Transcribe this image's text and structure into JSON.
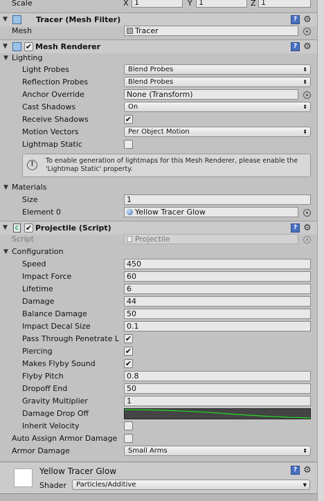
{
  "top": {
    "scale_label": "Scale",
    "x_label": "X",
    "x_value": "1",
    "y_label": "Y",
    "y_value": "1",
    "z_label": "Z",
    "z_value": "1"
  },
  "mesh_filter": {
    "title": "Tracer (Mesh Filter)",
    "mesh_label": "Mesh",
    "mesh_value": "Tracer"
  },
  "mesh_renderer": {
    "title": "Mesh Renderer",
    "lighting_label": "Lighting",
    "light_probes_label": "Light Probes",
    "light_probes_value": "Blend Probes",
    "reflection_probes_label": "Reflection Probes",
    "reflection_probes_value": "Blend Probes",
    "anchor_override_label": "Anchor Override",
    "anchor_override_value": "None (Transform)",
    "cast_shadows_label": "Cast Shadows",
    "cast_shadows_value": "On",
    "receive_shadows_label": "Receive Shadows",
    "motion_vectors_label": "Motion Vectors",
    "motion_vectors_value": "Per Object Motion",
    "lightmap_static_label": "Lightmap Static",
    "help_line1": "To enable generation of lightmaps for this Mesh Renderer, please enable the",
    "help_line2": "'Lightmap Static' property.",
    "materials_label": "Materials",
    "size_label": "Size",
    "size_value": "1",
    "element0_label": "Element 0",
    "element0_value": "Yellow Tracer Glow"
  },
  "projectile": {
    "title": "Projectile (Script)",
    "script_label": "Script",
    "script_value": "Projectile",
    "configuration_label": "Configuration",
    "speed_label": "Speed",
    "speed_value": "450",
    "impact_force_label": "Impact Force",
    "impact_force_value": "60",
    "lifetime_label": "Lifetime",
    "lifetime_value": "6",
    "damage_label": "Damage",
    "damage_value": "44",
    "balance_damage_label": "Balance Damage",
    "balance_damage_value": "50",
    "impact_decal_label": "Impact Decal Size",
    "impact_decal_value": "0.1",
    "pass_through_label": "Pass Through Penetrate L",
    "piercing_label": "Piercing",
    "flyby_sound_label": "Makes Flyby Sound",
    "flyby_pitch_label": "Flyby Pitch",
    "flyby_pitch_value": "0.8",
    "dropoff_end_label": "Dropoff End",
    "dropoff_end_value": "50",
    "gravity_label": "Gravity Multiplier",
    "gravity_value": "1",
    "damage_dropoff_label": "Damage Drop Off",
    "inherit_velocity_label": "Inherit Velocity",
    "auto_assign_label": "Auto Assign Armor Damage",
    "armor_damage_label": "Armor Damage",
    "armor_damage_value": "Small Arms",
    "curve_color": "#22dd22"
  },
  "material": {
    "name": "Yellow Tracer Glow",
    "shader_label": "Shader",
    "shader_value": "Particles/Additive"
  },
  "checkmark": "✔",
  "dropdown_arrow": "⬍",
  "help_glyph": "?",
  "gear_glyph": "⚙",
  "fold_open": "▼"
}
